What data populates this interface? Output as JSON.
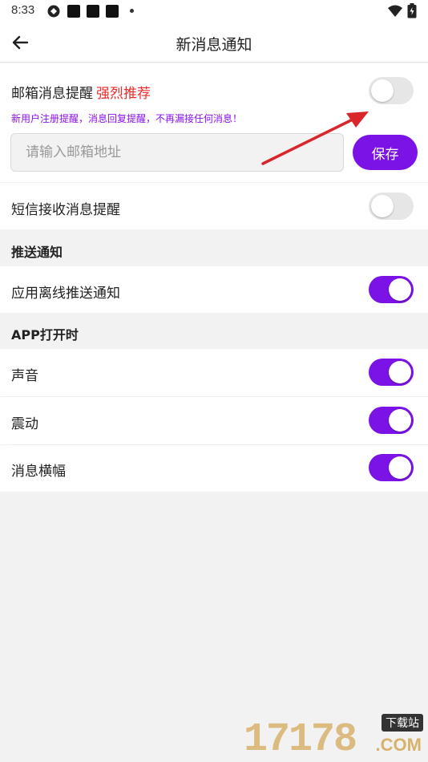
{
  "status_bar": {
    "time": "8:33",
    "icons": [
      "sync-icon",
      "notification-square-icon",
      "notification-square-icon",
      "notification-square-icon",
      "more-dot-icon",
      "wifi-icon",
      "battery-icon"
    ]
  },
  "header": {
    "title": "新消息通知",
    "back_icon": "back-arrow-icon"
  },
  "email_alert": {
    "label": "邮箱消息提醒",
    "recommend": "强烈推荐",
    "hint": "新用户注册提醒，消息回复提醒，不再漏接任何消息！",
    "enabled": false,
    "input_value": "",
    "input_placeholder": "请输入邮箱地址",
    "save_label": "保存"
  },
  "sms_alert": {
    "label": "短信接收消息提醒",
    "enabled": false
  },
  "push_section": {
    "title": "推送通知",
    "items": [
      {
        "label": "应用离线推送通知",
        "enabled": true
      }
    ]
  },
  "app_open_section": {
    "title": "APP打开时",
    "items": [
      {
        "label": "声音",
        "enabled": true
      },
      {
        "label": "震动",
        "enabled": true
      },
      {
        "label": "消息横幅",
        "enabled": true
      }
    ]
  },
  "watermark": {
    "digits": "17178",
    "tag": "下载站",
    "suffix": ".COM"
  },
  "colors": {
    "accent": "#7b12e6",
    "recommend": "#ee2a2a",
    "hint": "#8b10f0",
    "switch_off": "#e6e6e6",
    "annotation_arrow": "#d9262a"
  }
}
